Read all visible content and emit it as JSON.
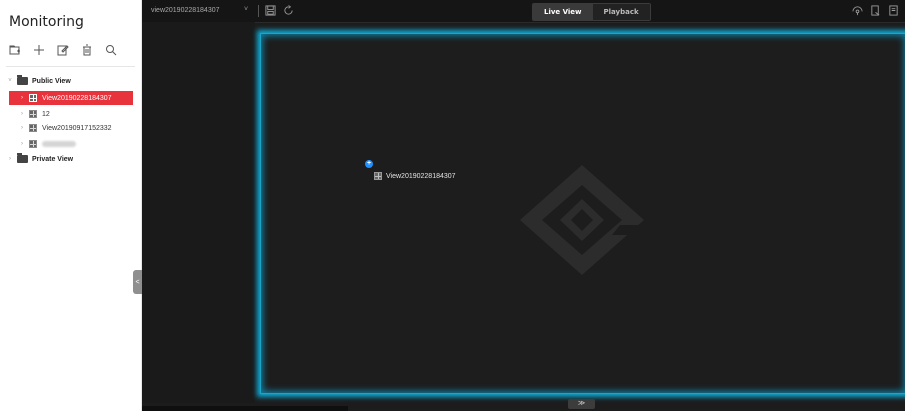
{
  "left_panel": {
    "title": "Monitoring",
    "toolbar": {
      "icons": [
        "new-folder-icon",
        "add-icon",
        "edit-icon",
        "delete-icon",
        "search-icon"
      ]
    },
    "tree": [
      {
        "label": "Public View",
        "type": "folder",
        "expanded": true
      },
      {
        "label": "View20190228184307",
        "type": "view",
        "selected": true
      },
      {
        "label": "12",
        "type": "view"
      },
      {
        "label": "View20190917152332",
        "type": "view"
      },
      {
        "label": "",
        "type": "view",
        "blurred": true
      },
      {
        "label": "Private View",
        "type": "folder",
        "expanded": false
      }
    ],
    "collapse_handle_label": "<"
  },
  "top_bar": {
    "current_view": "view20190228184307",
    "tabs": [
      {
        "label": "Live View",
        "active": true
      },
      {
        "label": "Playback",
        "active": false
      }
    ],
    "right_icons": [
      "ptz-icon",
      "export-icon",
      "fullscreen-icon"
    ]
  },
  "preview": {
    "badge": "+",
    "window_label": "View20190228184307",
    "bottom_toggle": "≫"
  },
  "colors": {
    "selected": "#e8323c",
    "canvas_glow": "#0fa9d3",
    "badge": "#1e90ff"
  }
}
